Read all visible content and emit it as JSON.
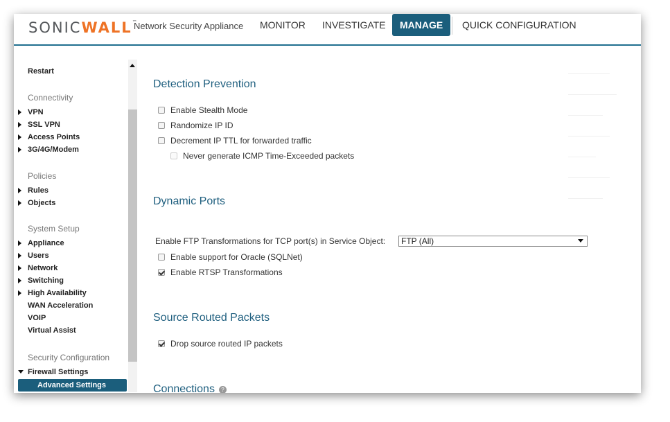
{
  "header": {
    "logo_main": "SONIC",
    "logo_accent": "WALL",
    "product": "Network Security Appliance",
    "nav": [
      "MONITOR",
      "INVESTIGATE",
      "MANAGE",
      "QUICK CONFIGURATION"
    ],
    "active_nav": "MANAGE"
  },
  "sidebar": {
    "top_items": [
      "Restart"
    ],
    "groups": [
      {
        "heading": "Connectivity",
        "items": [
          "VPN",
          "SSL VPN",
          "Access Points",
          "3G/4G/Modem"
        ]
      },
      {
        "heading": "Policies",
        "items": [
          "Rules",
          "Objects"
        ]
      },
      {
        "heading": "System Setup",
        "items": [
          "Appliance",
          "Users",
          "Network",
          "Switching",
          "High Availability",
          "WAN Acceleration",
          "VOIP",
          "Virtual Assist"
        ]
      },
      {
        "heading": "Security Configuration",
        "items": [
          "Firewall Settings"
        ]
      }
    ],
    "selected": "Advanced Settings"
  },
  "main": {
    "detection": {
      "title": "Detection Prevention",
      "options": [
        {
          "label": "Enable Stealth Mode",
          "checked": false
        },
        {
          "label": "Randomize IP ID",
          "checked": false
        },
        {
          "label": "Decrement IP TTL for forwarded traffic",
          "checked": false
        },
        {
          "label": "Never generate ICMP Time-Exceeded packets",
          "checked": false,
          "disabled": true
        }
      ]
    },
    "dynamic_ports": {
      "title": "Dynamic Ports",
      "ftp_label": "Enable FTP Transformations for TCP port(s) in Service Object:",
      "ftp_value": "FTP (All)",
      "options": [
        {
          "label": "Enable support for Oracle (SQLNet)",
          "checked": false
        },
        {
          "label": "Enable RTSP Transformations",
          "checked": true
        }
      ]
    },
    "source_routed": {
      "title": "Source Routed Packets",
      "options": [
        {
          "label": "Drop source routed IP packets",
          "checked": true
        }
      ]
    },
    "connections": {
      "title": "Connections",
      "help_glyph": "?"
    }
  }
}
